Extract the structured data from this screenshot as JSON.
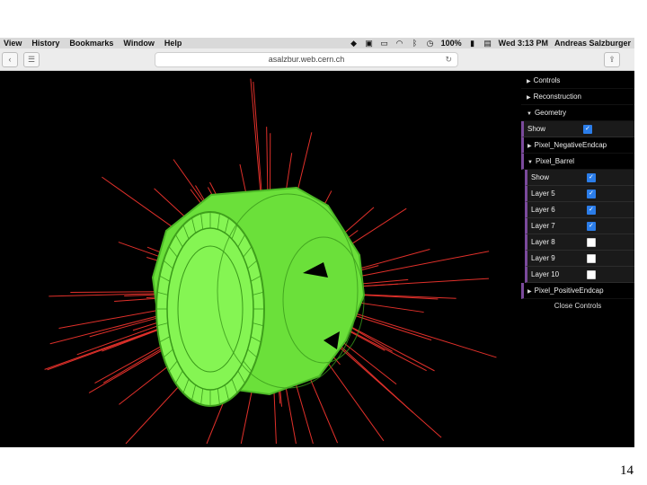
{
  "menubar": {
    "items": [
      "View",
      "History",
      "Bookmarks",
      "Window",
      "Help"
    ],
    "battery": "100%",
    "clock": "Wed 3:13 PM",
    "user": "Andreas Salzburger"
  },
  "toolbar": {
    "url": "asalzbur.web.cern.ch"
  },
  "gui": {
    "controls": "Controls",
    "reconstruction": "Reconstruction",
    "geometry": "Geometry",
    "geometry_show": "Show",
    "pixel_neg": "Pixel_NegativeEndcap",
    "pixel_barrel": "Pixel_Barrel",
    "barrel_show": "Show",
    "layers": [
      {
        "label": "Layer 5",
        "checked": true
      },
      {
        "label": "Layer 6",
        "checked": true
      },
      {
        "label": "Layer 7",
        "checked": true
      },
      {
        "label": "Layer 8",
        "checked": false
      },
      {
        "label": "Layer 9",
        "checked": false
      },
      {
        "label": "Layer 10",
        "checked": false
      }
    ],
    "pixel_pos": "Pixel_PositiveEndcap",
    "close": "Close Controls"
  },
  "colors": {
    "detector": "#7cf24a",
    "track": "#e0302a",
    "checkbox": "#2b7de9",
    "folder_border": "#7b4a9c"
  },
  "slide_number": "14"
}
